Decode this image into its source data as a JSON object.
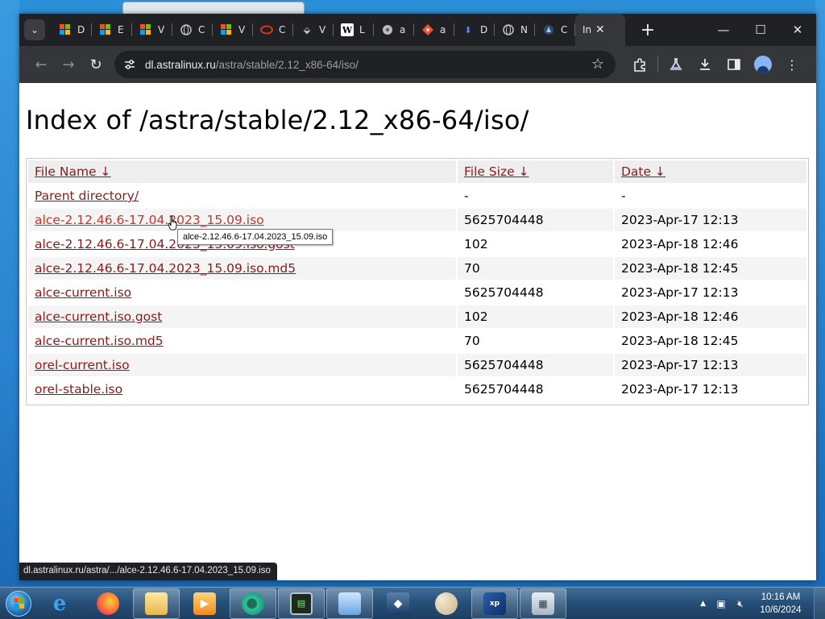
{
  "browser": {
    "tabs": [
      {
        "icon": "microsoft-icon",
        "label": "D"
      },
      {
        "icon": "microsoft-icon",
        "label": "E"
      },
      {
        "icon": "microsoft-icon",
        "label": "V"
      },
      {
        "icon": "globe-icon",
        "label": "C"
      },
      {
        "icon": "microsoft-icon",
        "label": "V"
      },
      {
        "icon": "oracle-icon",
        "label": "C"
      },
      {
        "icon": "app-icon",
        "label": "V"
      },
      {
        "icon": "wikipedia-icon",
        "label": "L"
      },
      {
        "icon": "disk-icon",
        "label": "a"
      },
      {
        "icon": "git-icon",
        "label": "a"
      },
      {
        "icon": "download-icon",
        "label": "D"
      },
      {
        "icon": "globe-icon",
        "label": "N"
      },
      {
        "icon": "astra-icon",
        "label": "C"
      },
      {
        "icon": "",
        "label": "In",
        "active": true
      }
    ],
    "url_host": "dl.astralinux.ru",
    "url_path": "/astra/stable/2.12_x86-64/iso/",
    "status_url": "dl.astralinux.ru/astra/.../alce-2.12.46.6-17.04.2023_15.09.iso"
  },
  "page": {
    "title": "Index of /astra/stable/2.12_x86-64/iso/",
    "columns": {
      "name": "File Name",
      "size": "File Size",
      "date": "Date",
      "sort_arrow": "↓"
    },
    "rows": [
      {
        "name": "Parent directory/",
        "size": "-",
        "date": "-"
      },
      {
        "name": "alce-2.12.46.6-17.04.2023_15.09.iso",
        "size": "5625704448",
        "date": "2023-Apr-17 12:13"
      },
      {
        "name": "alce-2.12.46.6-17.04.2023_15.09.iso.gost",
        "size": "102",
        "date": "2023-Apr-18 12:46"
      },
      {
        "name": "alce-2.12.46.6-17.04.2023_15.09.iso.md5",
        "size": "70",
        "date": "2023-Apr-18 12:45"
      },
      {
        "name": "alce-current.iso",
        "size": "5625704448",
        "date": "2023-Apr-17 12:13"
      },
      {
        "name": "alce-current.iso.gost",
        "size": "102",
        "date": "2023-Apr-18 12:46"
      },
      {
        "name": "alce-current.iso.md5",
        "size": "70",
        "date": "2023-Apr-18 12:45"
      },
      {
        "name": "orel-current.iso",
        "size": "5625704448",
        "date": "2023-Apr-17 12:13"
      },
      {
        "name": "orel-stable.iso",
        "size": "5625704448",
        "date": "2023-Apr-17 12:13"
      }
    ],
    "tooltip": "alce-2.12.46.6-17.04.2023_15.09.iso"
  },
  "taskbar": {
    "apps": [
      {
        "name": "internet-explorer-icon",
        "open": false
      },
      {
        "name": "firefox-icon",
        "open": false
      },
      {
        "name": "file-explorer-icon",
        "open": true
      },
      {
        "name": "media-player-icon",
        "open": false
      },
      {
        "name": "chrome-icon",
        "open": true
      },
      {
        "name": "terminal-icon",
        "open": true
      },
      {
        "name": "control-panel-icon",
        "open": true
      },
      {
        "name": "virtualbox-icon",
        "open": false
      },
      {
        "name": "paint-icon",
        "open": false
      },
      {
        "name": "xp-mode-icon",
        "open": true
      },
      {
        "name": "calculator-icon",
        "open": true
      }
    ],
    "time": "10:16 AM",
    "date": "10/6/2024"
  },
  "colors": {
    "link": "#8b1a1a",
    "chrome_dark": "#202124",
    "chrome_toolbar": "#35363a"
  }
}
